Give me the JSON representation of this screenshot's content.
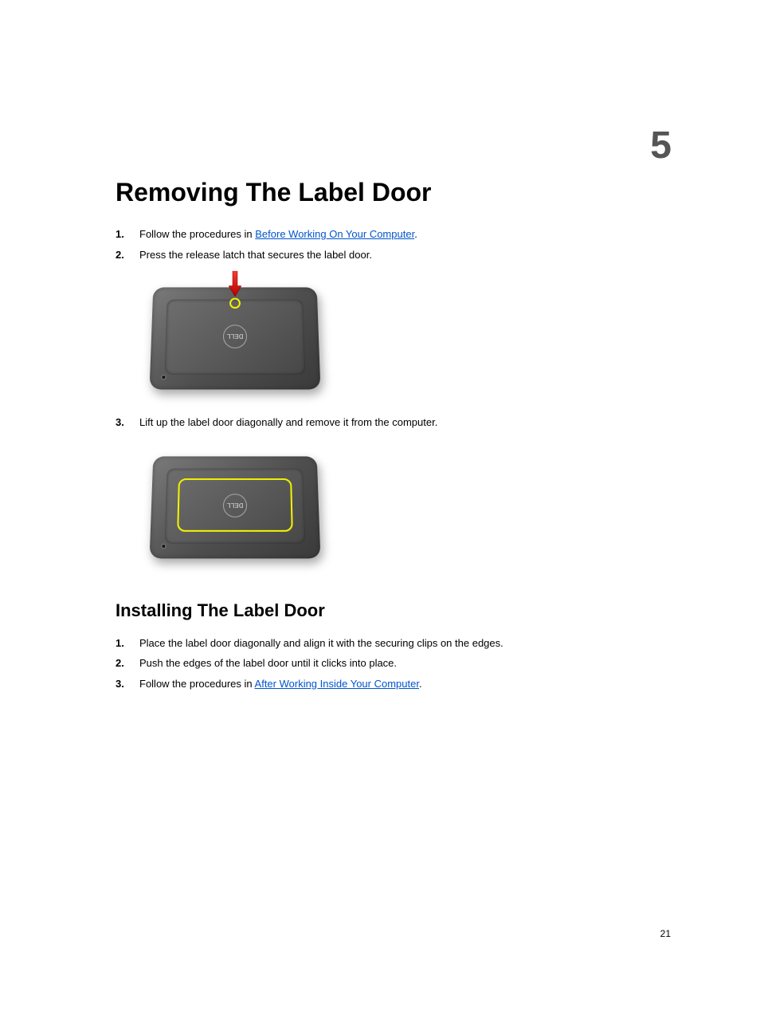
{
  "chapter_number": "5",
  "title": "Removing The Label Door",
  "list1": {
    "item1_prefix": "Follow the procedures in ",
    "item1_link": "Before Working On Your Computer",
    "item1_suffix": ".",
    "item2": "Press the release latch that secures the label door.",
    "item3": "Lift up the label door diagonally and remove it from the computer."
  },
  "subtitle": "Installing The Label Door",
  "list2": {
    "item1": "Place the label door diagonally and align it with the securing clips on the edges.",
    "item2": "Push the edges of the label door until it clicks into place.",
    "item3_prefix": "Follow the procedures in ",
    "item3_link": "After Working Inside Your Computer",
    "item3_suffix": "."
  },
  "page_number": "21",
  "logo_text": "DELL"
}
